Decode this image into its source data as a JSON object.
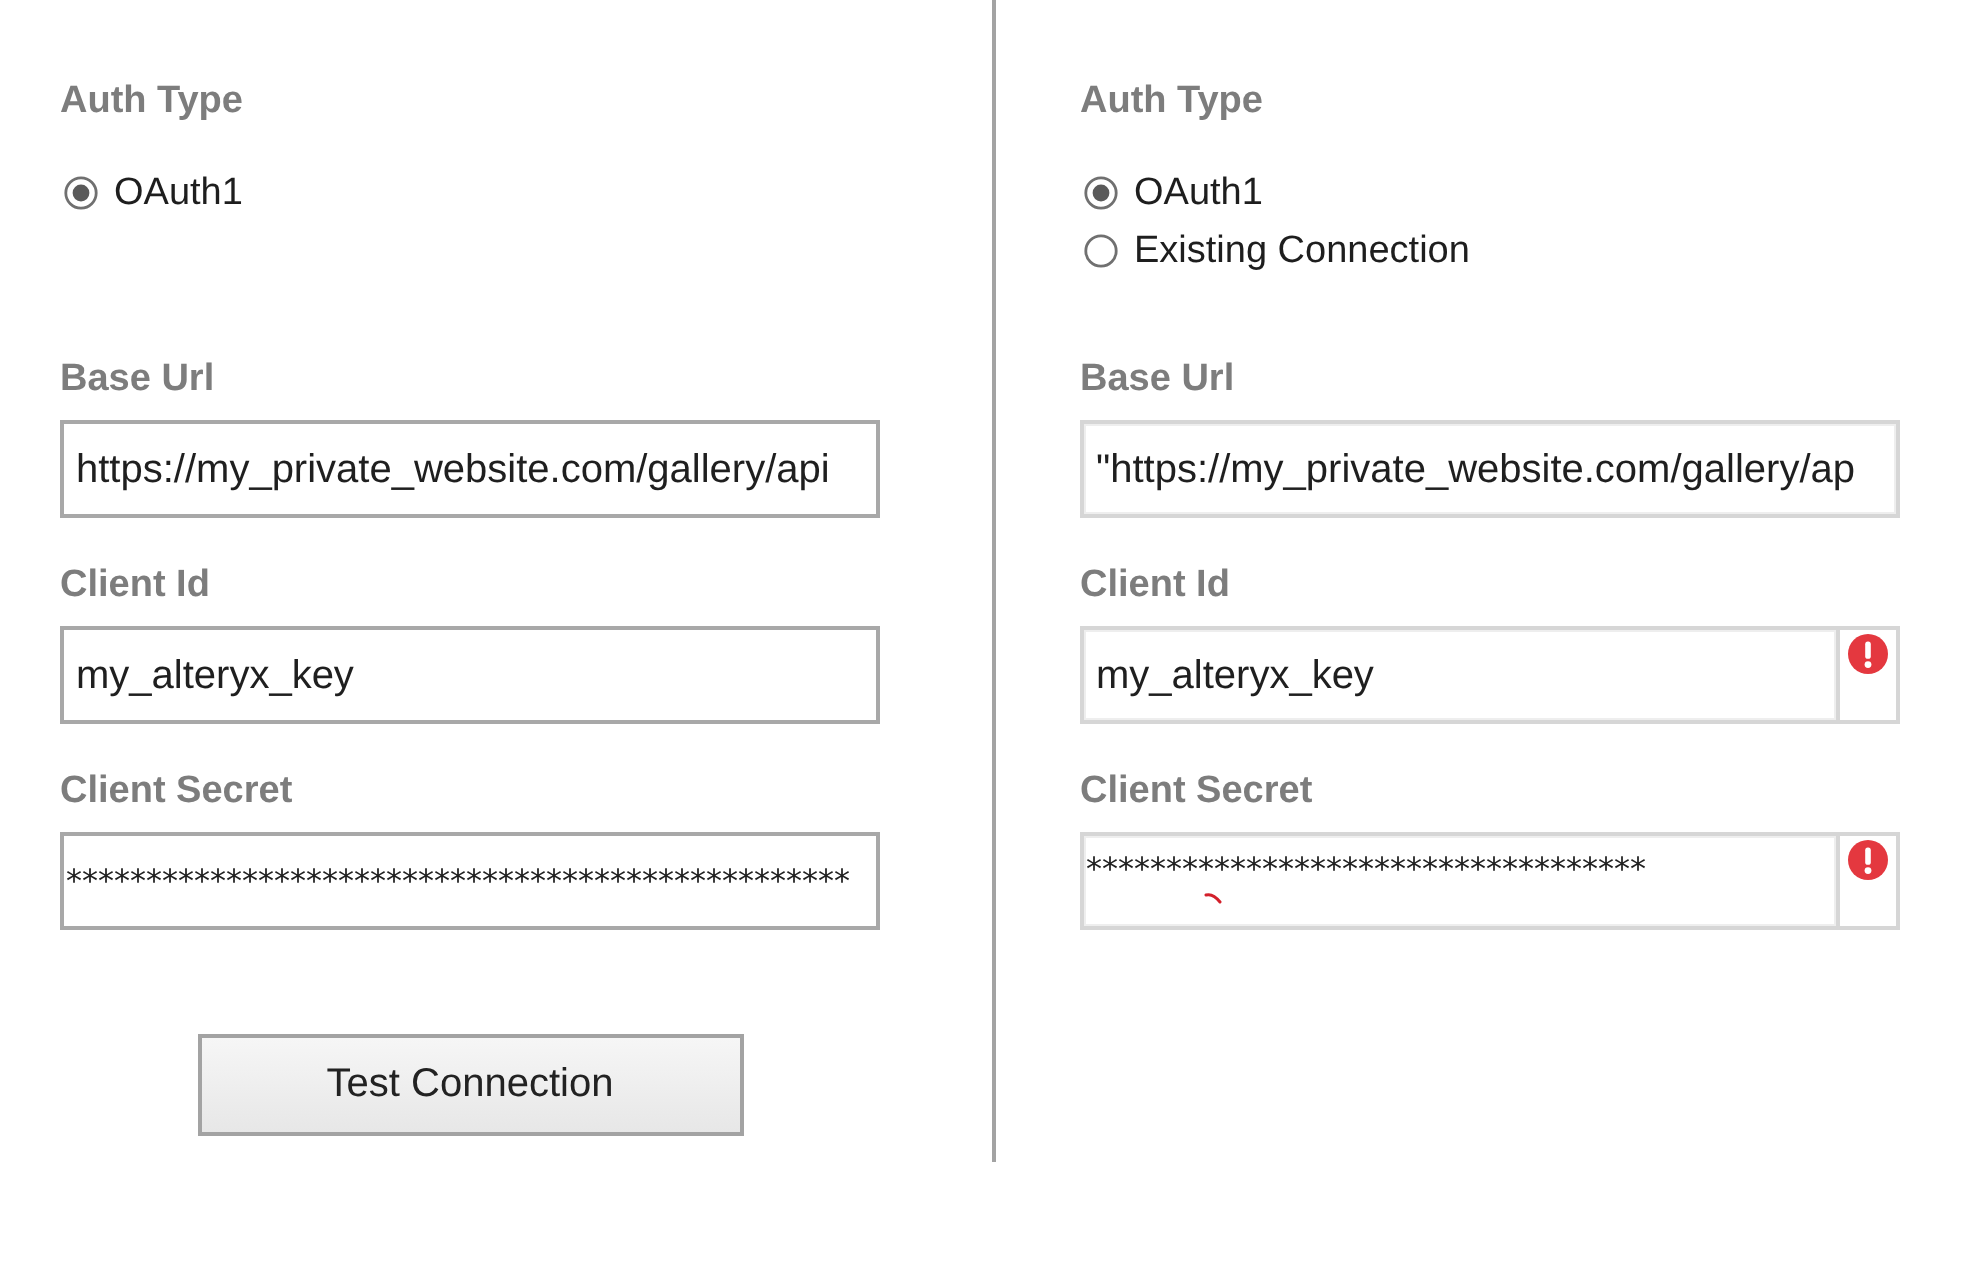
{
  "panels": [
    {
      "kind": "classic",
      "auth_type": {
        "label": "Auth Type",
        "options": [
          {
            "label": "OAuth1",
            "selected": true
          }
        ]
      },
      "fields": [
        {
          "label": "Base Url",
          "value": "https://my_private_website.com/gallery/api",
          "kind": "text",
          "error": false,
          "multiline": false,
          "spell_mark": false
        },
        {
          "label": "Client Id",
          "value": "my_alteryx_key",
          "kind": "text",
          "error": false,
          "multiline": false,
          "spell_mark": false
        },
        {
          "label": "Client Secret",
          "value": "*************************************************",
          "kind": "secret",
          "error": false,
          "multiline": false,
          "spell_mark": false
        }
      ],
      "button": {
        "label": "Test Connection"
      }
    },
    {
      "kind": "flat",
      "auth_type": {
        "label": "Auth Type",
        "options": [
          {
            "label": "OAuth1",
            "selected": true
          },
          {
            "label": "Existing Connection",
            "selected": false
          }
        ]
      },
      "fields": [
        {
          "label": "Base Url",
          "value": "\"https://my_private_website.com/gallery/ap",
          "kind": "text",
          "error": false,
          "multiline": false,
          "spell_mark": false
        },
        {
          "label": "Client Id",
          "value": "my_alteryx_key",
          "kind": "text",
          "error": true,
          "multiline": false,
          "spell_mark": false
        },
        {
          "label": "Client Secret",
          "value": "***********************************",
          "kind": "secret",
          "error": true,
          "multiline": true,
          "spell_mark": true
        }
      ]
    }
  ]
}
